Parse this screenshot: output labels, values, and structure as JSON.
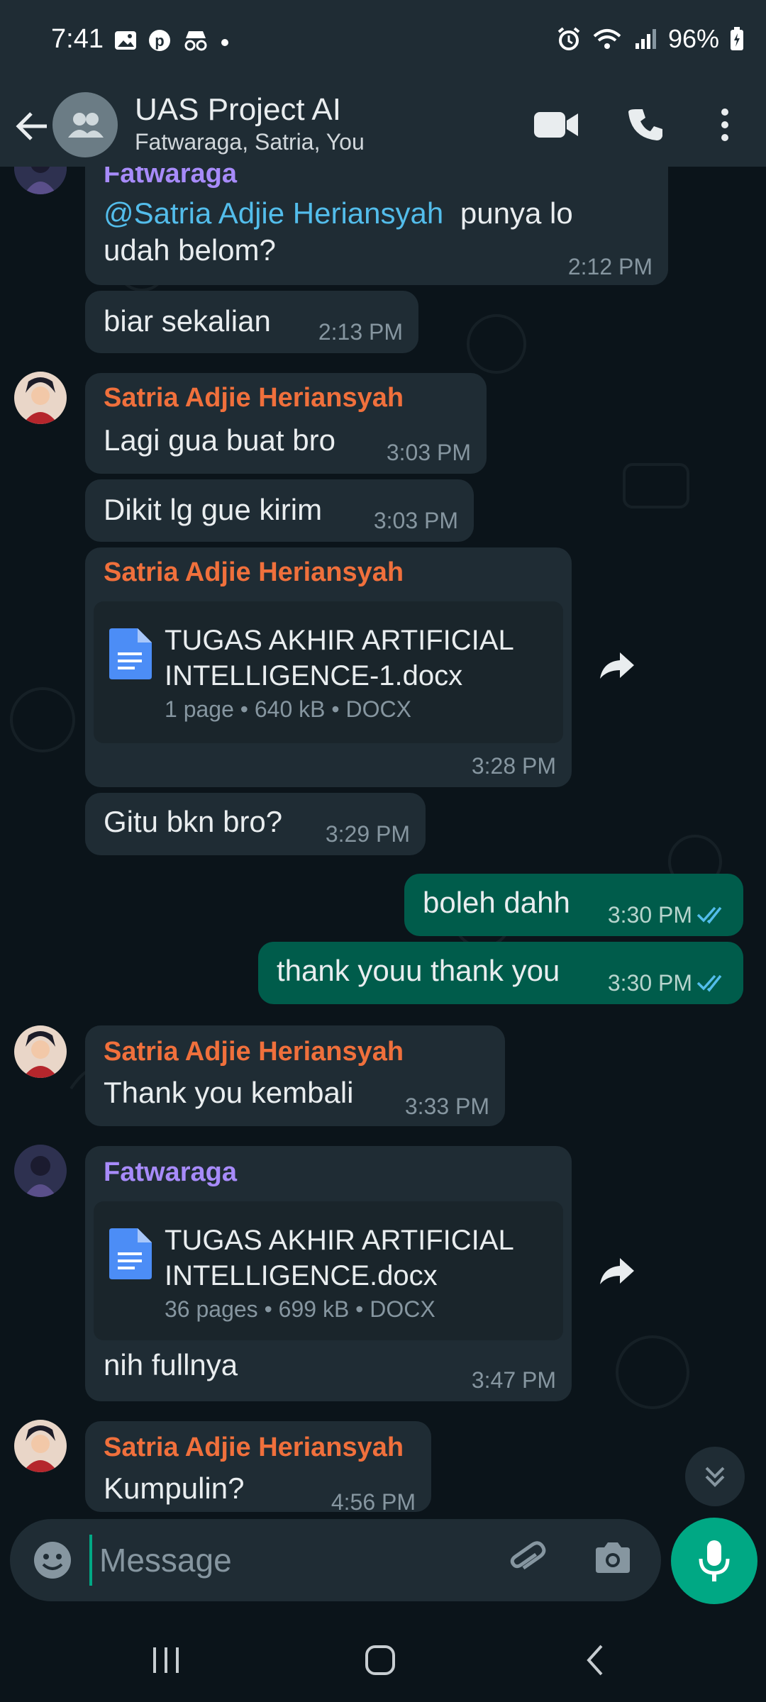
{
  "status_bar": {
    "time": "7:41",
    "battery": "96%"
  },
  "header": {
    "title": "UAS Project AI",
    "subtitle": "Fatwaraga, Satria, You"
  },
  "messages": {
    "m1": {
      "sender": "Fatwaraga",
      "mention": "@Satria Adjie Heriansyah",
      "text_after": " punya lo",
      "text_line2": "udah belom?",
      "time": "2:12 PM"
    },
    "m2": {
      "text": "biar sekalian",
      "time": "2:13 PM"
    },
    "m3": {
      "sender": "Satria Adjie Heriansyah",
      "text": "Lagi gua buat bro",
      "time": "3:03 PM"
    },
    "m4": {
      "text": "Dikit lg gue kirim",
      "time": "3:03 PM"
    },
    "m5": {
      "sender": "Satria Adjie Heriansyah",
      "doc_line1": "TUGAS AKHIR ARTIFICIAL",
      "doc_line2": "INTELLIGENCE-1.docx",
      "doc_meta": "1 page • 640 kB • DOCX",
      "time": "3:28 PM"
    },
    "m6": {
      "text": "Gitu bkn bro?",
      "time": "3:29 PM"
    },
    "m7": {
      "text": "boleh dahh",
      "time": "3:30 PM"
    },
    "m8": {
      "text": "thank youu thank you",
      "time": "3:30 PM"
    },
    "m9": {
      "sender": "Satria Adjie Heriansyah",
      "text": "Thank you kembali",
      "time": "3:33 PM"
    },
    "m10": {
      "sender": "Fatwaraga",
      "doc_line1": "TUGAS AKHIR ARTIFICIAL",
      "doc_line2": "INTELLIGENCE.docx",
      "doc_meta": "36 pages • 699 kB • DOCX",
      "caption": "nih fullnya",
      "time": "3:47 PM"
    },
    "m11": {
      "sender": "Satria Adjie Heriansyah",
      "text": "Kumpulin?",
      "time": "4:56 PM"
    }
  },
  "composer": {
    "placeholder": "Message"
  },
  "colors": {
    "fatwaraga": "#a78bfa",
    "satria": "#f0703c",
    "accent": "#00a884",
    "read_tick": "#53bdeb"
  }
}
